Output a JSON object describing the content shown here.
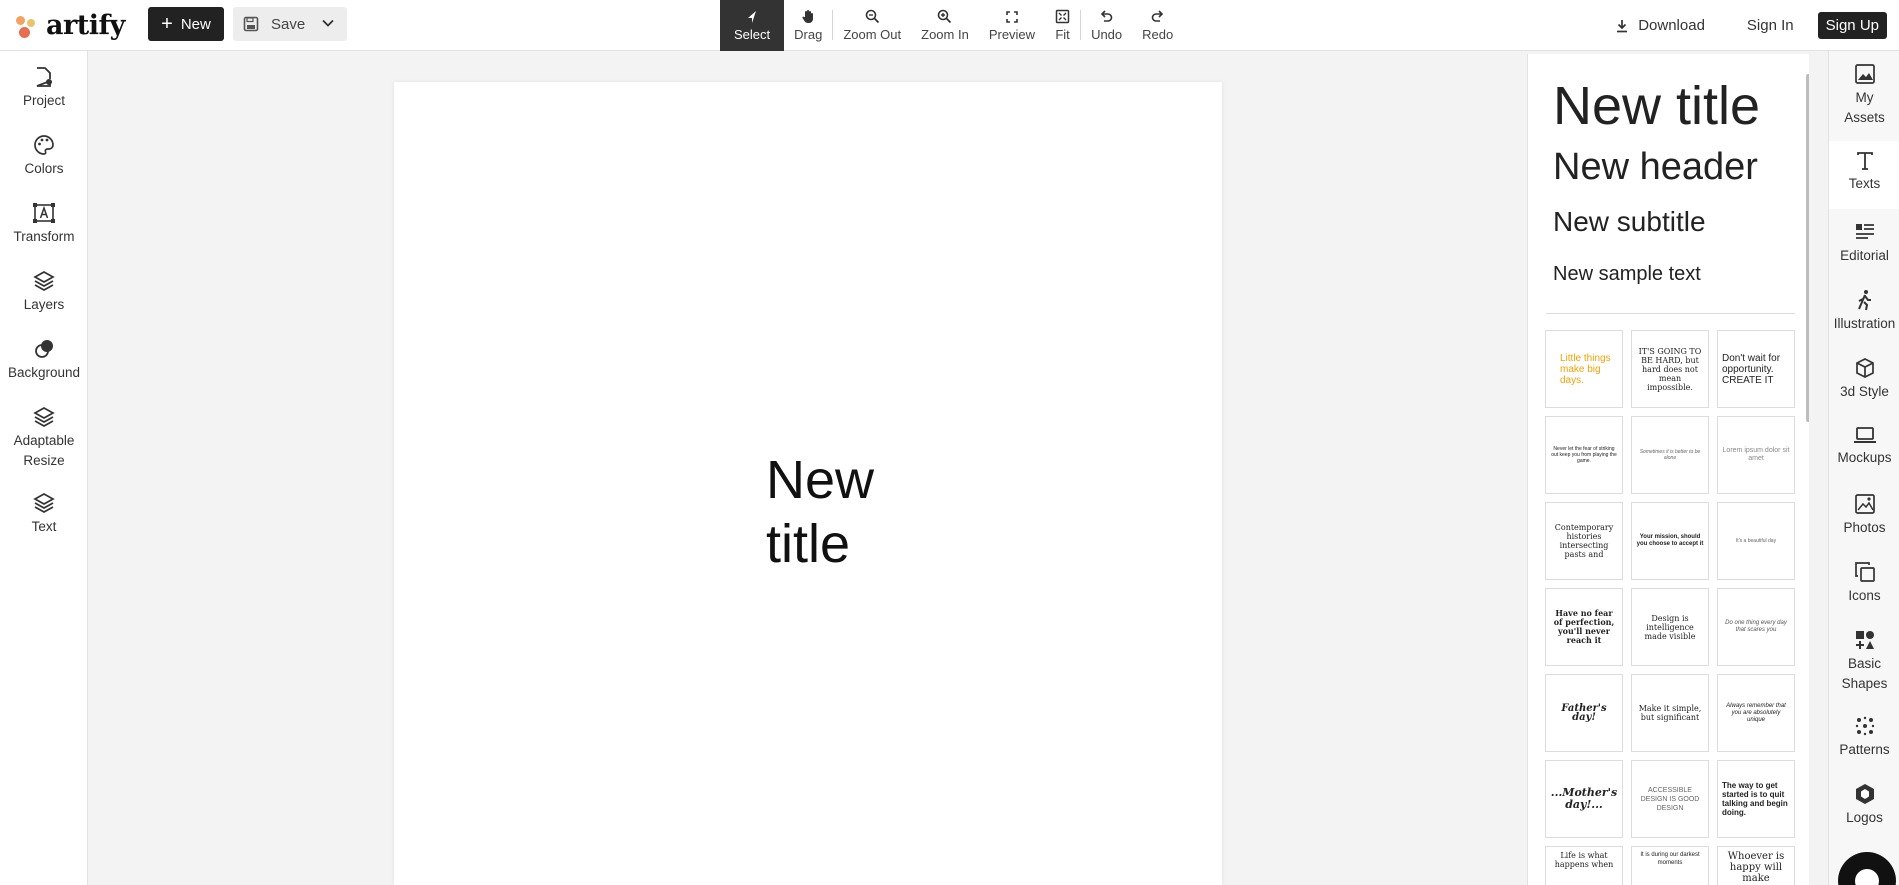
{
  "app": {
    "logo_text": "artify"
  },
  "topbar": {
    "new_label": "New",
    "save_label": "Save",
    "tools": [
      {
        "label": "Select",
        "icon": "cursor-icon",
        "active": true
      },
      {
        "label": "Drag",
        "icon": "hand-icon"
      },
      {
        "label": "Zoom Out",
        "icon": "zoom-out-icon"
      },
      {
        "label": "Zoom In",
        "icon": "zoom-in-icon"
      },
      {
        "label": "Preview",
        "icon": "fullscreen-icon"
      },
      {
        "label": "Fit",
        "icon": "fit-icon"
      },
      {
        "label": "Undo",
        "icon": "undo-icon"
      },
      {
        "label": "Redo",
        "icon": "redo-icon"
      }
    ],
    "download_label": "Download",
    "signin_label": "Sign In",
    "signup_label": "Sign Up"
  },
  "leftbar": {
    "items": [
      {
        "label": "Project",
        "icon": "project-icon"
      },
      {
        "label": "Colors",
        "icon": "palette-icon"
      },
      {
        "label": "Transform",
        "icon": "transform-icon"
      },
      {
        "label": "Layers",
        "icon": "layers-icon"
      },
      {
        "label": "Background",
        "icon": "background-icon"
      },
      {
        "label": "Adaptable Resize",
        "icon": "resize-icon"
      },
      {
        "label": "Text",
        "icon": "text-layers-icon"
      }
    ]
  },
  "canvas": {
    "title_text": "New title"
  },
  "panel": {
    "title": "New title",
    "header": "New header",
    "subtitle": "New subtitle",
    "sample": "New sample text",
    "templates": [
      "Little things make big days.",
      "IT'S GOING TO BE HARD, but hard does not mean impossible.",
      "Don't wait for opportunity. CREATE IT",
      "Never let the fear of striking out keep you from playing the game.",
      "Sometimes it is better to be alone",
      "Lorem ipsum dolor sit amet",
      "Contemporary histories intersecting pasts and",
      "Your mission, should you choose to accept it",
      "It's a beautiful day",
      "Have no fear of perfection, you'll never reach it",
      "Design is intelligence made visible",
      "Do one thing every day that scares you",
      "Father's day!",
      "Make it simple, but significant",
      "Always remember that you are absolutely unique",
      "...Mother's day!...",
      "ACCESSIBLE DESIGN IS GOOD DESIGN",
      "The way to get started is to quit talking and begin doing.",
      "Life is what happens when",
      "It is during our darkest moments",
      "Whoever is happy will make"
    ]
  },
  "rightbar": {
    "items": [
      {
        "label": "My Assets",
        "icon": "image-icon"
      },
      {
        "label": "Texts",
        "icon": "text-icon",
        "active": true
      },
      {
        "label": "Editorial",
        "icon": "editorial-icon"
      },
      {
        "label": "Illustration",
        "icon": "walking-person-icon"
      },
      {
        "label": "3d Style",
        "icon": "cube-icon"
      },
      {
        "label": "Mockups",
        "icon": "laptop-icon"
      },
      {
        "label": "Photos",
        "icon": "photo-icon"
      },
      {
        "label": "Icons",
        "icon": "copy-icon"
      },
      {
        "label": "Basic Shapes",
        "icon": "shapes-icon"
      },
      {
        "label": "Patterns",
        "icon": "dots-icon"
      },
      {
        "label": "Logos",
        "icon": "logo-hex-icon"
      }
    ]
  },
  "colors": {
    "accent": "#222222",
    "highlight": "#f4a100"
  }
}
